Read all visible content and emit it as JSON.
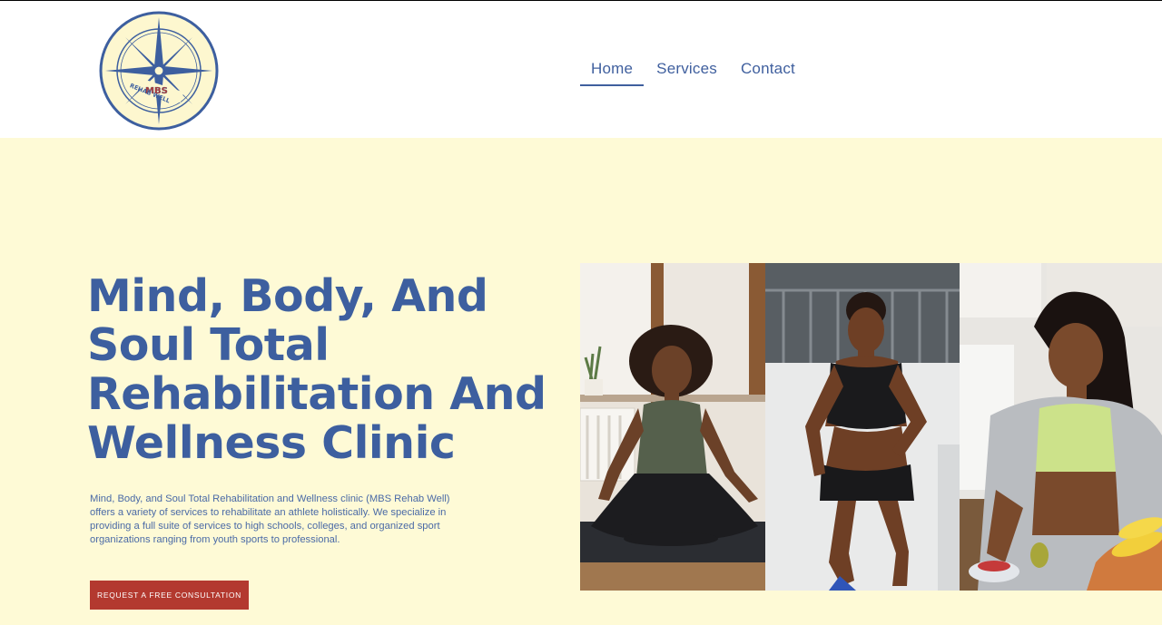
{
  "brand": {
    "logo_top_text": "MBS",
    "logo_ring_text": "REHAB WELL",
    "logo_icon": "compass-rose-icon"
  },
  "nav": {
    "items": [
      {
        "label": "Home",
        "active": true
      },
      {
        "label": "Services",
        "active": false
      },
      {
        "label": "Contact",
        "active": false
      }
    ]
  },
  "hero": {
    "title": "Mind, Body, And Soul Total Rehabilitation And Wellness Clinic",
    "description": "Mind, Body, and Soul Total Rehabilitation and Wellness clinic (MBS Rehab Well) offers a variety of services to rehabilitate an athlete holistically.  We specialize in providing a full suite of services to high schools, colleges, and organized sport organizations ranging from youth sports to professional.",
    "cta_label": "REQUEST A FREE CONSULTATION"
  },
  "photos": [
    "meditation-photo",
    "running-photo",
    "cooking-photo"
  ],
  "colors": {
    "brand_blue": "#3d5f9f",
    "hero_bg": "#fefad6",
    "cta_red": "#b3392f",
    "logo_fill": "#fdf7cf"
  }
}
